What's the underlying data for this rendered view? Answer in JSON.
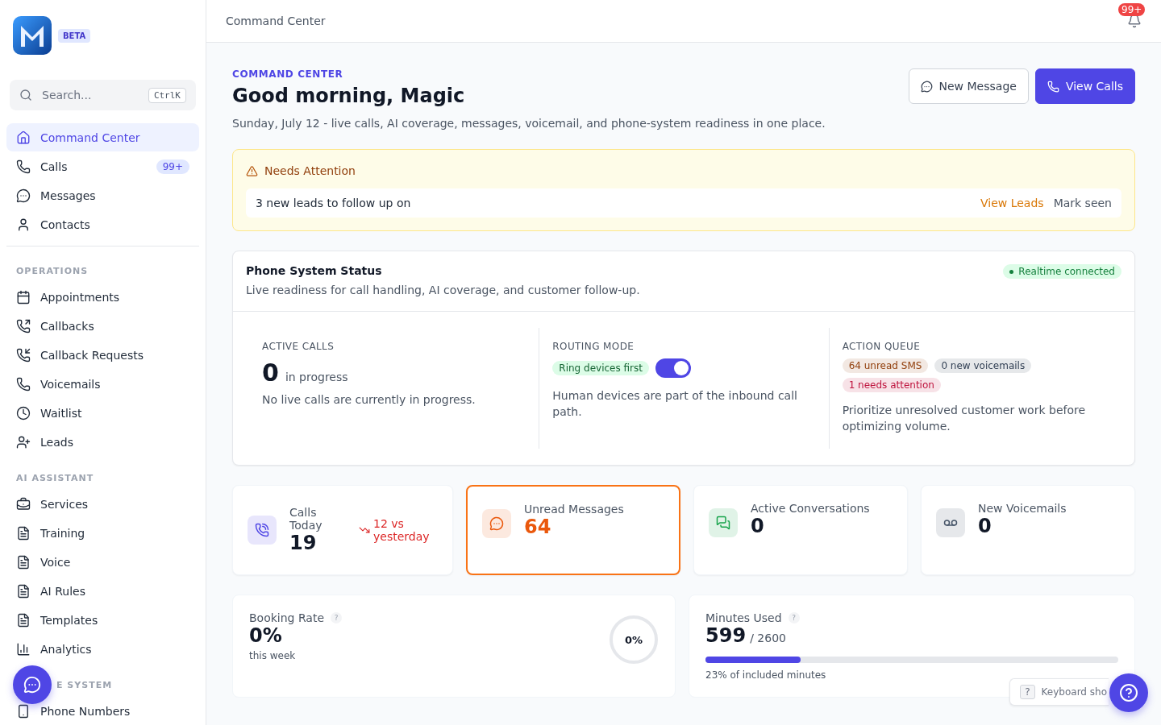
{
  "brand": {
    "badge": "BETA"
  },
  "search": {
    "placeholder": "Search...",
    "shortcut": "CtrlK"
  },
  "sidebar": {
    "main": [
      {
        "label": "Command Center",
        "selected": true
      },
      {
        "label": "Calls",
        "selected": false,
        "badge": "99+"
      },
      {
        "label": "Messages",
        "selected": false
      },
      {
        "label": "Contacts",
        "selected": false
      }
    ],
    "sections": [
      {
        "title": "OPERATIONS",
        "items": [
          {
            "label": "Appointments",
            "selected": false
          },
          {
            "label": "Callbacks",
            "selected": false
          },
          {
            "label": "Callback Requests",
            "selected": false
          },
          {
            "label": "Voicemails",
            "selected": false
          },
          {
            "label": "Waitlist",
            "selected": false
          },
          {
            "label": "Leads",
            "selected": false
          }
        ]
      },
      {
        "title": "AI ASSISTANT",
        "items": [
          {
            "label": "Services",
            "selected": false
          },
          {
            "label": "Training",
            "selected": false
          },
          {
            "label": "Voice",
            "selected": false
          },
          {
            "label": "AI Rules",
            "selected": false
          },
          {
            "label": "Templates",
            "selected": false
          },
          {
            "label": "Analytics",
            "selected": false
          }
        ]
      },
      {
        "title": "E SYSTEM",
        "items": [
          {
            "label": "Phone Numbers",
            "selected": false
          }
        ]
      }
    ]
  },
  "topbar": {
    "breadcrumb": "Command Center",
    "notifications": "99+"
  },
  "header": {
    "eyebrow": "COMMAND CENTER",
    "title": "Good morning, Magic",
    "subtitle": "Sunday, July 12 - live calls, AI coverage, messages, voicemail, and phone-system readiness in one place.",
    "buttons": [
      {
        "label": "New Message",
        "kind": "secondary"
      },
      {
        "label": "View Calls",
        "kind": "primary"
      }
    ]
  },
  "alert": {
    "title": "Needs Attention",
    "message": "3 new leads to follow up on",
    "actions": [
      {
        "label": "View Leads",
        "kind": "link"
      },
      {
        "label": "Mark seen",
        "kind": "muted"
      }
    ]
  },
  "status": {
    "title": "Phone System Status",
    "subtitle": "Live readiness for call handling, AI coverage, and customer follow-up.",
    "badge": "Realtime connected",
    "active_calls": {
      "label": "ACTIVE CALLS",
      "value": "0",
      "unit": "in progress",
      "note": "No live calls are currently in progress."
    },
    "routing": {
      "label": "ROUTING MODE",
      "chip": "Ring devices first",
      "on": true,
      "note": "Human devices are part of the inbound call path."
    },
    "queue": {
      "label": "ACTION QUEUE",
      "chips": [
        {
          "text": "64 unread SMS",
          "color": "#92400e"
        },
        {
          "text": "0 new voicemails",
          "color": "#334155"
        },
        {
          "text": "1 needs attention",
          "color": "#be123c"
        }
      ],
      "note": "Prioritize unresolved customer work before optimizing volume."
    }
  },
  "stats": [
    {
      "label": "Calls Today",
      "value": "19",
      "trend": "12 vs yesterday",
      "selected": false,
      "color": "#4f46e5"
    },
    {
      "label": "Unread Messages",
      "value": "64",
      "selected": true,
      "color": "#ea580c"
    },
    {
      "label": "Active Conversations",
      "value": "0",
      "selected": false,
      "color": "#16a34a"
    },
    {
      "label": "New Voicemails",
      "value": "0",
      "selected": false,
      "color": "#475569"
    }
  ],
  "booking": {
    "label": "Booking Rate",
    "help": "?",
    "value": "0%",
    "caption": "this week",
    "ring_label": "0%",
    "level": 0
  },
  "minutes": {
    "label": "Minutes Used",
    "help": "?",
    "value": "599",
    "total": "/ 2600",
    "level": 0.23,
    "caption": "23% of included minutes"
  },
  "shortcut_hint": {
    "key": "?",
    "text": "Keyboard sho"
  }
}
